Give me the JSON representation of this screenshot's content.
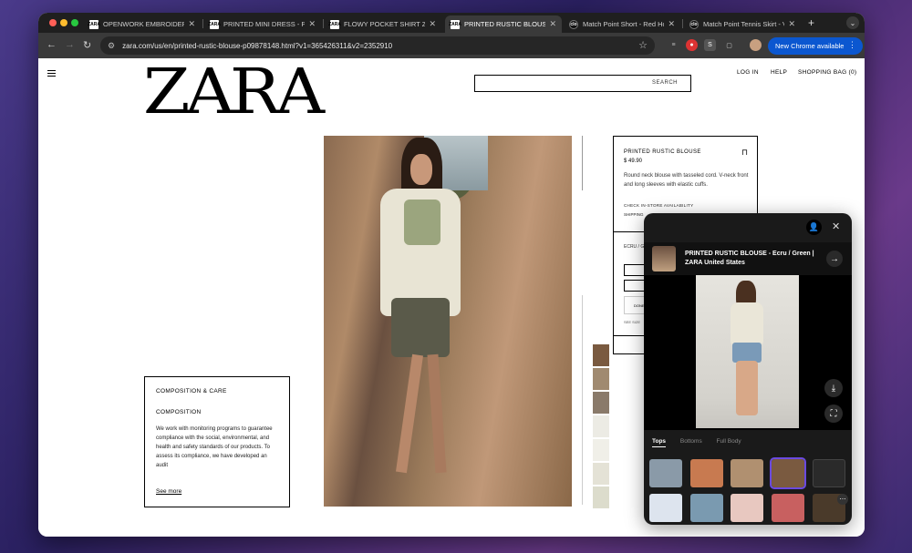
{
  "browser": {
    "tabs": [
      {
        "favicon": "ZARA",
        "title": "OPENWORK EMBROIDERED"
      },
      {
        "favicon": "ZARA",
        "title": "PRINTED MINI DRESS - Pink"
      },
      {
        "favicon": "ZARA",
        "title": "FLOWY POCKET SHIRT ZW"
      },
      {
        "favicon": "ZARA",
        "title": "PRINTED RUSTIC BLOUSE"
      },
      {
        "favicon": "clo",
        "title": "Match Point Short - Red Ho"
      },
      {
        "favicon": "clo",
        "title": "Match Point Tennis Skirt - V"
      }
    ],
    "url": "zara.com/us/en/printed-rustic-blouse-p09878148.html?v1=365426311&v2=2352910",
    "new_chrome_label": "New Chrome available"
  },
  "site": {
    "logo": "ZARA",
    "search_label": "SEARCH",
    "login": "LOG IN",
    "help": "HELP",
    "bag": "SHOPPING BAG (0)"
  },
  "composition": {
    "heading": "COMPOSITION & CARE",
    "subheading": "COMPOSITION",
    "text": "We work with monitoring programs to guarantee compliance with the social, environmental, and health and safety standards of our products. To assess its compliance, we have developed an audit",
    "see_more": "See more"
  },
  "product": {
    "name": "PRINTED RUSTIC BLOUSE",
    "price": "$ 49.90",
    "description": "Round neck blouse with tasseled cord. V-neck front and long sleeves with elastic cuffs.",
    "check_store": "CHECK IN-STORE AVAILABILITY",
    "shipping": "SHIPPING",
    "color": "ECRU / G",
    "add_label": "DONE",
    "see_label": "SEE SIZE"
  },
  "overlay": {
    "title": "PRINTED RUSTIC BLOUSE - Ecru / Green | ZARA United States",
    "tabs": [
      "Tops",
      "Bottoms",
      "Full Body"
    ],
    "active_tab": "Tops",
    "colors": {
      "accent": "#6a4ae0",
      "chrome_blue": "#0b57d0"
    }
  }
}
